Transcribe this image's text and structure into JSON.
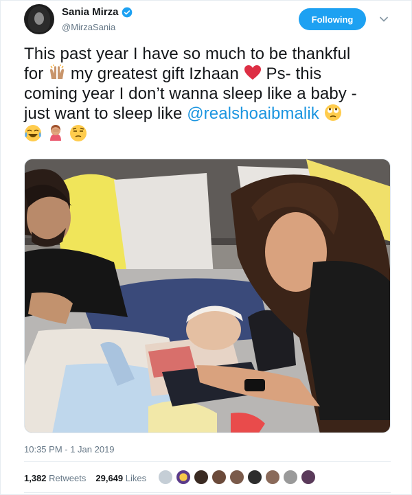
{
  "header": {
    "display_name": "Sania Mirza",
    "handle": "@MirzaSania",
    "follow_button": "Following",
    "verified_icon": "verified-badge-icon",
    "menu_icon": "chevron-down-icon"
  },
  "tweet": {
    "line1": "This past year I have so much to be thankful",
    "line2a": "for ",
    "line2b": " my greatest gift Izhaan ",
    "line2c": " Ps- this",
    "line3": "coming year I don’t wanna sleep like a baby -",
    "line4a": "just want to sleep like ",
    "mention": "@realshoaibmalik",
    "emojis": [
      "raised-hands-emoji",
      "red-heart-emoji",
      "rolling-eyes-emoji",
      "tears-of-joy-emoji",
      "facepalm-emoji",
      "unamused-emoji"
    ]
  },
  "meta": {
    "timestamp": "10:35 PM - 1 Jan 2019",
    "retweets_count": "1,382",
    "retweets_label": "Retweets",
    "likes_count": "29,649",
    "likes_label": "Likes"
  },
  "colors": {
    "accent": "#1da1f2",
    "mention": "#1b95e0",
    "secondary_text": "#657786"
  }
}
